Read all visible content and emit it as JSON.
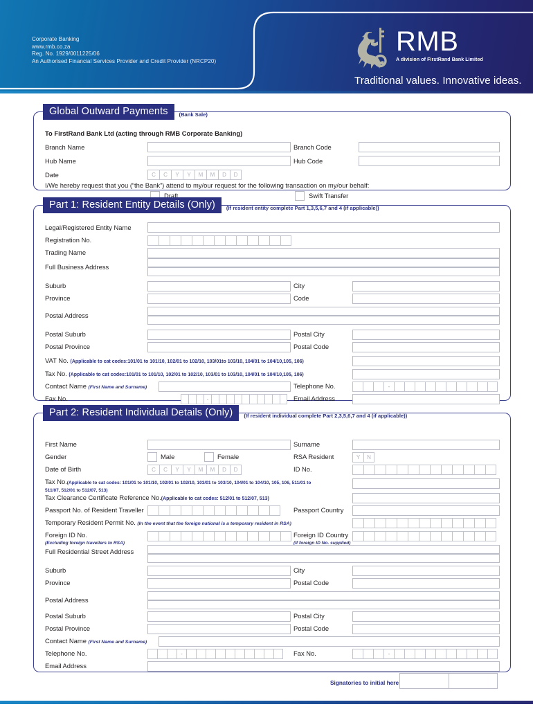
{
  "header": {
    "corporate_lines": [
      "Corporate Banking",
      "www.rmb.co.za",
      "Reg. No. 1929/0011225/06",
      "An Authorised Financial Services Provider and Credit Provider (NRCP20)"
    ],
    "logo_text": "RMB",
    "logo_subtitle": "A division of FirstRand Bank Limited",
    "tagline": "Traditional values. Innovative ideas.",
    "brand_navy": "#242166",
    "brand_blue": "#1277b4",
    "logo_emblem_color": "#b3b3a6"
  },
  "section0": {
    "title": "Global Outward Payments",
    "note": "(Bank Sale)",
    "intro": "To FirstRand Bank Ltd (acting through RMB Corporate Banking)",
    "branch_name_label": "Branch Name",
    "branch_code_label": "Branch Code",
    "hub_name_label": "Hub Name",
    "hub_code_label": "Hub Code",
    "date_label": "Date",
    "date_cells": [
      "C",
      "C",
      "Y",
      "Y",
      "M",
      "M",
      "D",
      "D"
    ],
    "request_text": "I/We hereby request that you (“the Bank”) attend to my/our request for the following transaction on my/our behalf:",
    "draft_label": "Draft",
    "swift_label": "Swift Transfer"
  },
  "part1": {
    "title": "Part 1: Resident Entity Details (Only)",
    "note": "(If resident entity complete Part 1,3,5,6,7 and 4 (if applicable))",
    "legal_name_label": "Legal/Registered Entity Name",
    "registration_label": "Registration No.",
    "registration_cells": 13,
    "trading_name_label": "Trading Name",
    "business_address_label": "Full Business Address",
    "suburb_label": "Suburb",
    "city_label": "City",
    "province_label": "Province",
    "code_label": "Code",
    "postal_address_label": "Postal Address",
    "postal_suburb_label": "Postal Suburb",
    "postal_city_label": "Postal City",
    "postal_province_label": "Postal Province",
    "postal_code_label": "Postal Code",
    "vat_label": "VAT No.",
    "vat_hint": "(Applicable to cat codes:101/01 to 101/10, 102/01 to 102/10, 103/01to 103/10, 104/01 to 104/10,105, 106)",
    "tax_label": "Tax No.",
    "tax_hint": "(Applicable to cat codes:101/01 to 101/10, 102/01 to 102/10, 103/01 to 103/10, 104/01 to 104/10,105, 106)",
    "contact_label": "Contact Name",
    "contact_hint": "(First Name and Surname)",
    "telephone_label": "Telephone No.",
    "fax_label": "Fax No.",
    "email_label": "Email Address"
  },
  "part2": {
    "title": "Part 2: Resident Individual Details (Only)",
    "note": "(If resident individual complete Part 2,3,5,6,7 and 4 (if applicable))",
    "first_name_label": "First Name",
    "surname_label": "Surname",
    "gender_label": "Gender",
    "male_label": "Male",
    "female_label": "Female",
    "rsa_resident_label": "RSA Resident",
    "rsa_yes": "Y",
    "rsa_no": "N",
    "dob_label": "Date of Birth",
    "dob_cells": [
      "C",
      "C",
      "Y",
      "Y",
      "M",
      "M",
      "D",
      "D"
    ],
    "id_no_label": "ID No.",
    "id_cells": 13,
    "tax_label": "Tax No.",
    "tax_hint_line1": "(Applicable to cat codes: 101/01 to 101/10, 102/01 to 102/10, 103/01 to 103/10, 104/01 to 104/10, 105, 106, 511/01 to",
    "tax_hint_line2": "511/07, 512/01 to 512/07, 513)",
    "tax_clearance_label": "Tax Clearance Certificate Reference No.",
    "tax_clearance_hint": "(Applicable to cat codes: 512/01 to 512/07, 513)",
    "passport_label": "Passport No. of Resident Traveller",
    "passport_cells": 12,
    "passport_country_label": "Passport Country",
    "permit_label": "Temporary Resident Permit No.",
    "permit_hint": "(In the event that the foreign national is a temporary resident in RSA)",
    "permit_cells": 13,
    "foreign_id_label": "Foreign ID No.",
    "foreign_id_hint": "(Excluding foreign travellers to RSA)",
    "foreign_id_cells": 13,
    "foreign_country_label": "Foreign ID Country",
    "foreign_country_hint": "(If foreign ID No. supplied)",
    "foreign_country_cells": 13,
    "residential_address_label": "Full Residential Street Address",
    "suburb_label": "Suburb",
    "city_label": "City",
    "province_label": "Province",
    "postal_code_label": "Postal Code",
    "postal_address_label": "Postal Address",
    "postal_suburb_label": "Postal Suburb",
    "postal_city_label": "Postal City",
    "postal_province_label": "Postal Province",
    "postal_code2_label": "Postal Code",
    "contact_label": "Contact Name",
    "contact_hint": "(First Name and Surname)",
    "telephone_label": "Telephone No.",
    "fax_label": "Fax No.",
    "email_label": "Email Address"
  },
  "footer": {
    "signatories_label": "Signatories to initial here"
  }
}
